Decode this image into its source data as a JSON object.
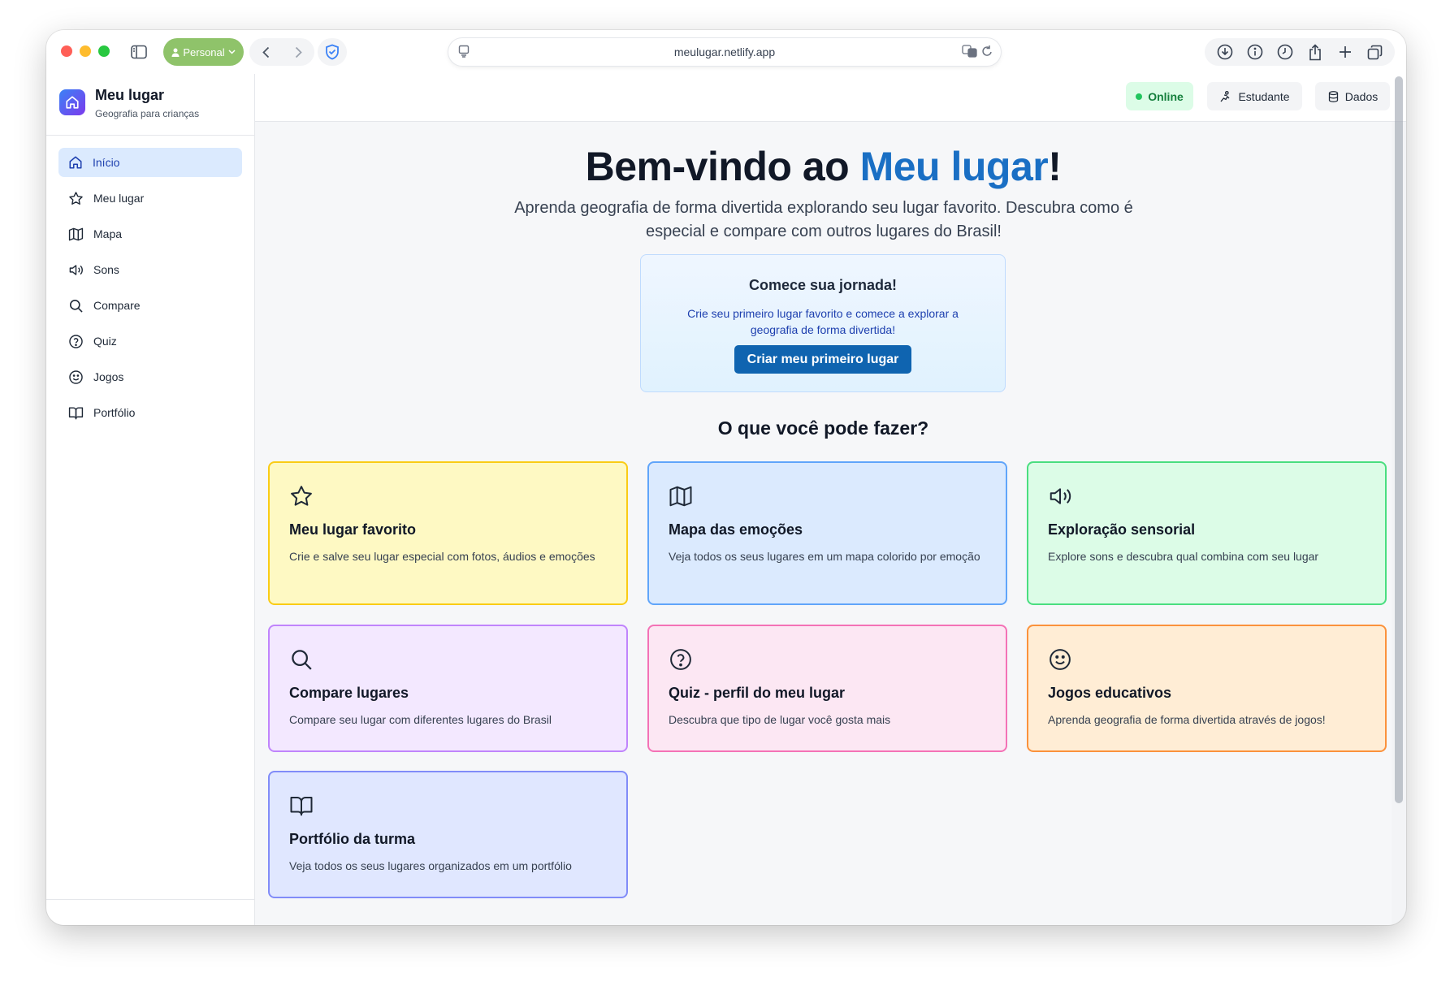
{
  "browser": {
    "profile_label": "Personal",
    "url": "meulugar.netlify.app"
  },
  "sidebar": {
    "brand_title": "Meu lugar",
    "brand_subtitle": "Geografia para crianças",
    "items": [
      {
        "label": "Início",
        "icon": "home-icon",
        "active": true
      },
      {
        "label": "Meu lugar",
        "icon": "star-icon"
      },
      {
        "label": "Mapa",
        "icon": "map-icon"
      },
      {
        "label": "Sons",
        "icon": "volume-icon"
      },
      {
        "label": "Compare",
        "icon": "search-icon"
      },
      {
        "label": "Quiz",
        "icon": "help-circle-icon"
      },
      {
        "label": "Jogos",
        "icon": "smile-icon"
      },
      {
        "label": "Portfólio",
        "icon": "book-icon"
      }
    ]
  },
  "header": {
    "status": "Online",
    "student_label": "Estudante",
    "data_label": "Dados"
  },
  "hero": {
    "title_prefix": "Bem-vindo ao ",
    "title_accent": "Meu lugar",
    "title_suffix": "!",
    "subtitle": "Aprenda geografia de forma divertida explorando seu lugar favorito. Descubra como é especial e compare com outros lugares do Brasil!"
  },
  "journey": {
    "title": "Comece sua jornada!",
    "text": "Crie seu primeiro lugar favorito e comece a explorar a geografia de forma divertida!",
    "button": "Criar meu primeiro lugar"
  },
  "features_title": "O que você pode fazer?",
  "features": [
    {
      "title": "Meu lugar favorito",
      "desc": "Crie e salve seu lugar especial com fotos, áudios e emoções",
      "icon": "star-icon"
    },
    {
      "title": "Mapa das emoções",
      "desc": "Veja todos os seus lugares em um mapa colorido por emoção",
      "icon": "map-icon"
    },
    {
      "title": "Exploração sensorial",
      "desc": "Explore sons e descubra qual combina com seu lugar",
      "icon": "volume-icon"
    },
    {
      "title": "Compare lugares",
      "desc": "Compare seu lugar com diferentes lugares do Brasil",
      "icon": "search-icon"
    },
    {
      "title": "Quiz - perfil do meu lugar",
      "desc": "Descubra que tipo de lugar você gosta mais",
      "icon": "help-circle-icon"
    },
    {
      "title": "Jogos educativos",
      "desc": "Aprenda geografia de forma divertida através de jogos!",
      "icon": "smile-icon"
    },
    {
      "title": "Portfólio da turma",
      "desc": "Veja todos os seus lugares organizados em um portfólio",
      "icon": "book-icon"
    }
  ]
}
